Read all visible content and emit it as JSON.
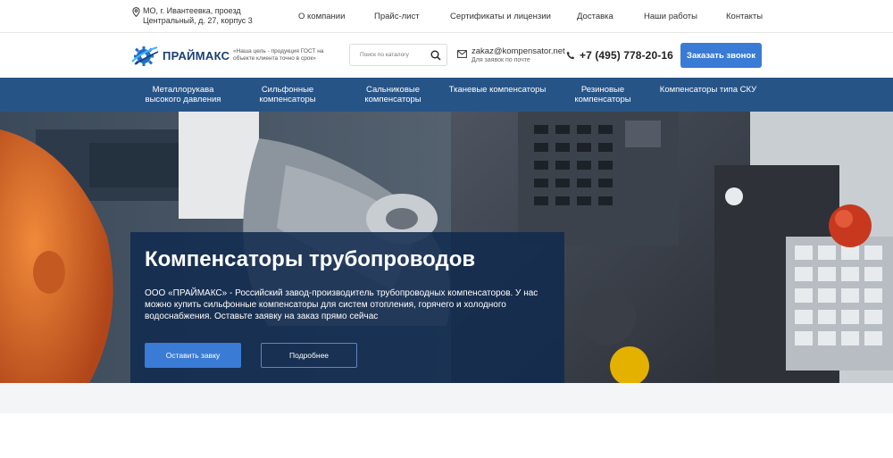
{
  "topbar": {
    "address": "МО, г. Ивантеевка, проезд Центральный, д. 27, корпус 3",
    "nav": [
      "О компании",
      "Прайс-лист",
      "Сертификаты и лицензии",
      "Доставка",
      "Наши работы",
      "Контакты"
    ]
  },
  "header": {
    "logo_text": "ПРАЙМАКС",
    "slogan": "«Наша цель - продукция ГОСТ на объекте клиента точно в срок»",
    "search_placeholder": "Поиск по каталогу",
    "email": "zakaz@kompensator.net",
    "email_note": "Для заявок по почте",
    "phone": "+7 (495) 778-20-16",
    "call_button": "Заказать звонок"
  },
  "categories": [
    "Металлорукава высокого давления",
    "Сильфонные компенсаторы",
    "Сальниковые компенсаторы",
    "Тканевые компенсаторы",
    "Резиновые компенсаторы",
    "Компенсаторы типа СКУ"
  ],
  "hero": {
    "title": "Компенсаторы трубопроводов",
    "text": "ООО «ПРАЙМАКС» - Российский завод-производитель трубопроводных компенсаторов. У нас можно купить сильфонные компенсаторы для систем отопления, горячего и холодного водоснабжения. Оставьте заявку на заказ прямо сейчас",
    "primary_button": "Оставить завку",
    "secondary_button": "Подробнее"
  },
  "colors": {
    "accent": "#3a7bd5",
    "nav_bg": "#275487",
    "panel_bg": "#102a4e"
  }
}
